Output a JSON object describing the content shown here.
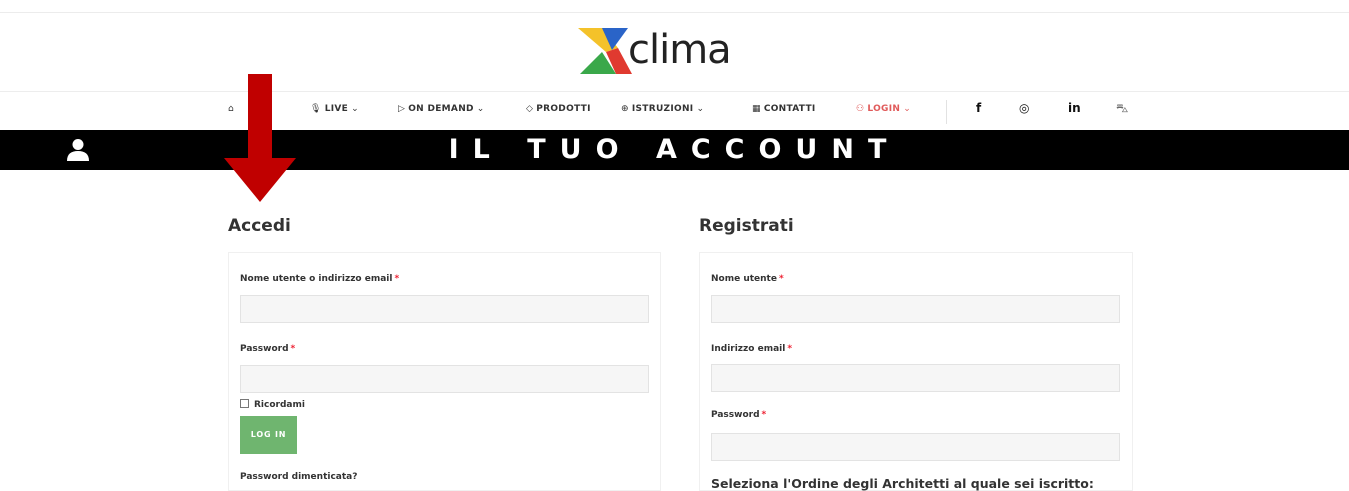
{
  "logo": {
    "word": "clima"
  },
  "nav": {
    "items": [
      {
        "icon": "⌂",
        "label": "",
        "chevron": ""
      },
      {
        "icon": "🎙",
        "label": "LIVE",
        "chevron": "⌄"
      },
      {
        "icon": "▷",
        "label": "ON DEMAND",
        "chevron": "⌄"
      },
      {
        "icon": "◇",
        "label": "PRODOTTI",
        "chevron": ""
      },
      {
        "icon": "⊕",
        "label": "ISTRUZIONI",
        "chevron": "⌄"
      },
      {
        "icon": "▦",
        "label": "CONTATTI",
        "chevron": ""
      },
      {
        "icon": "⚇",
        "label": "LOGIN",
        "chevron": "⌄"
      }
    ],
    "social": {
      "facebook": "f",
      "instagram": "◎",
      "linkedin": "in",
      "cart": "⛍"
    },
    "login_color": "#e05a5a"
  },
  "banner": {
    "title": "IL TUO ACCOUNT",
    "icon": "user-icon"
  },
  "login": {
    "title": "Accedi",
    "username_label": "Nome utente o indirizzo email",
    "password_label": "Password",
    "required_mark": "*",
    "remember_label": "Ricordami",
    "button": "LOG IN",
    "forgot": "Password dimenticata?"
  },
  "register": {
    "title": "Registrati",
    "username_label": "Nome utente",
    "email_label": "Indirizzo email",
    "password_label": "Password",
    "required_mark": "*",
    "ordine_label": "Seleziona l'Ordine degli Architetti al quale sei iscritto:"
  },
  "colors": {
    "banner": "#000000",
    "button": "#6fb56f",
    "arrow": "#c00000",
    "required": "#ee2233"
  }
}
